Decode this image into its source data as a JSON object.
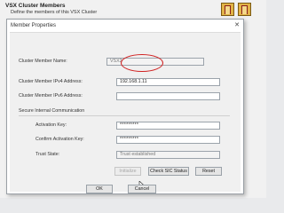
{
  "background": {
    "title": "VSX Cluster Members",
    "subtitle": "Define the members of this VSX Cluster"
  },
  "dialog": {
    "title": "Member Properties",
    "close_glyph": "✕",
    "fields": {
      "member_name": {
        "label": "Cluster Member Name:",
        "value": "VSX2"
      },
      "ipv4": {
        "label": "Cluster Member IPv4 Address:",
        "value": "192.168.1.11"
      },
      "ipv6": {
        "label": "Cluster Member IPv6 Address:",
        "value": ""
      }
    },
    "sic_group": {
      "title": "Secure Internal Communication",
      "activation_key": {
        "label": "Activation Key:",
        "value": "*********"
      },
      "confirm_key": {
        "label": "Confirm Activation Key:",
        "value": "*********"
      },
      "trust_state": {
        "label": "Trust State:",
        "value": "Trust established"
      },
      "initialize_label": "Initialize",
      "check_sic_label": "Check SIC Status",
      "reset_label": "Reset"
    },
    "ok_label": "OK",
    "cancel_label": "Cancel"
  },
  "colors": {
    "highlight_circle": "#d02020",
    "dialog_bg": "#f0f0f0"
  }
}
